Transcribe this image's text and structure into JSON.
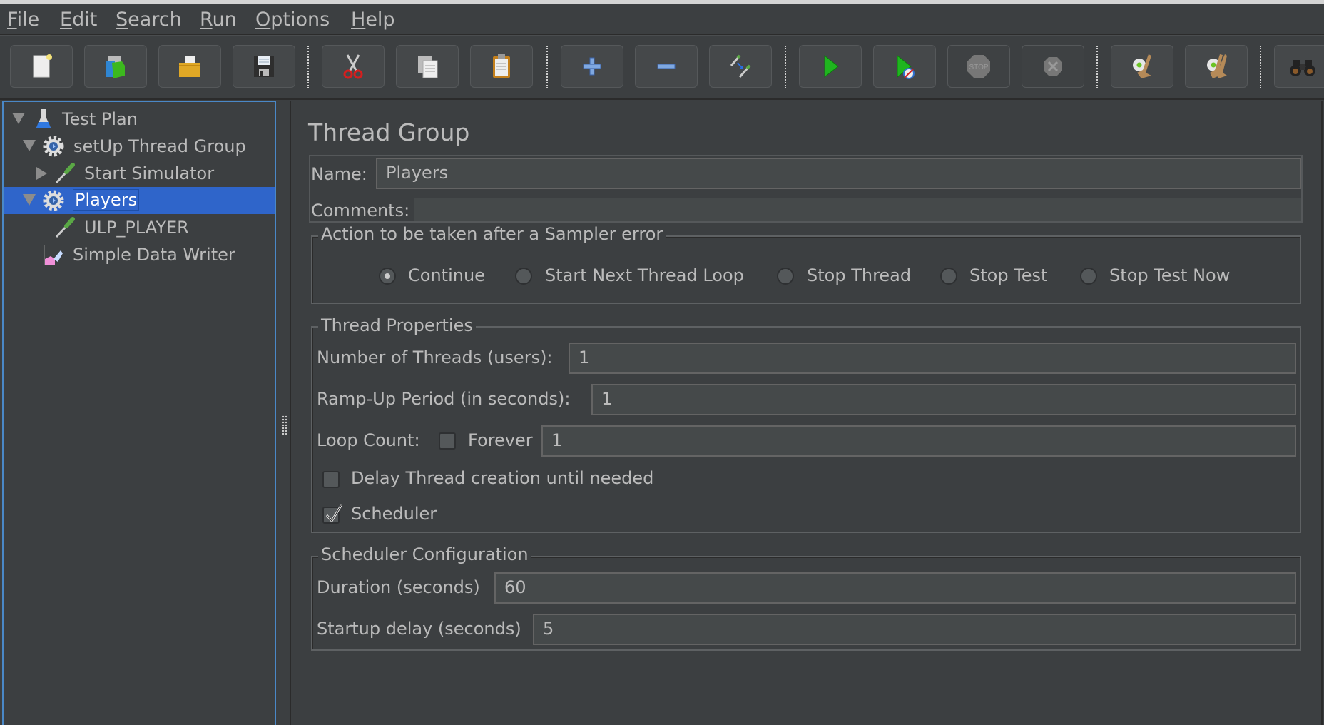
{
  "menu": [
    "File",
    "Edit",
    "Search",
    "Run",
    "Options",
    "Help"
  ],
  "menu_mnemonics": [
    "F",
    "E",
    "S",
    "R",
    "O",
    "H"
  ],
  "toolbar": {
    "buttons": [
      {
        "name": "new",
        "icon": "new-document-icon",
        "enabled": true
      },
      {
        "name": "templates",
        "icon": "templates-icon",
        "enabled": true
      },
      {
        "name": "open",
        "icon": "open-folder-icon",
        "enabled": true
      },
      {
        "name": "save",
        "icon": "save-floppy-icon",
        "enabled": true
      },
      {
        "name": "cut",
        "icon": "scissors-icon",
        "enabled": true
      },
      {
        "name": "copy",
        "icon": "copy-icon",
        "enabled": true
      },
      {
        "name": "paste",
        "icon": "paste-clipboard-icon",
        "enabled": true
      },
      {
        "name": "expand-all",
        "icon": "plus-icon",
        "enabled": true
      },
      {
        "name": "collapse-all",
        "icon": "minus-icon",
        "enabled": true
      },
      {
        "name": "toggle",
        "icon": "toggle-pipette-icon",
        "enabled": true
      },
      {
        "name": "start",
        "icon": "play-icon",
        "enabled": true
      },
      {
        "name": "start-no-pauses",
        "icon": "play-no-timers-icon",
        "enabled": true
      },
      {
        "name": "stop",
        "icon": "stop-sign-icon",
        "enabled": false
      },
      {
        "name": "shutdown",
        "icon": "shutdown-x-icon",
        "enabled": false
      },
      {
        "name": "clear",
        "icon": "clear-broom-icon",
        "enabled": true
      },
      {
        "name": "clear-all",
        "icon": "clear-all-broom-icon",
        "enabled": true
      },
      {
        "name": "search",
        "icon": "binoculars-icon",
        "enabled": true
      }
    ]
  },
  "tree": {
    "items": [
      {
        "label": "Test Plan",
        "icon": "test-plan-flask-icon",
        "expanded": true,
        "level": 0,
        "selected": false
      },
      {
        "label": "setUp Thread Group",
        "icon": "thread-group-gear-icon",
        "expanded": true,
        "level": 1,
        "selected": false
      },
      {
        "label": "Start Simulator",
        "icon": "sampler-pipette-icon",
        "expanded": false,
        "level": 2,
        "selected": false
      },
      {
        "label": "Players",
        "icon": "thread-group-gear-icon",
        "expanded": true,
        "level": 1,
        "selected": true
      },
      {
        "label": "ULP_PLAYER",
        "icon": "sampler-pipette-icon",
        "expanded": null,
        "level": 2,
        "selected": false
      },
      {
        "label": "Simple Data Writer",
        "icon": "listener-chart-icon",
        "expanded": null,
        "level": 1,
        "selected": false
      }
    ]
  },
  "panel": {
    "title": "Thread Group",
    "name_label": "Name:",
    "name_value": "Players",
    "comments_label": "Comments:",
    "comments_value": "",
    "sampler_error": {
      "legend": "Action to be taken after a Sampler error",
      "options": [
        "Continue",
        "Start Next Thread Loop",
        "Stop Thread",
        "Stop Test",
        "Stop Test Now"
      ],
      "selected": "Continue"
    },
    "thread_properties": {
      "legend": "Thread Properties",
      "num_threads_label": "Number of Threads (users):",
      "num_threads_value": "1",
      "rampup_label": "Ramp-Up Period (in seconds):",
      "rampup_value": "1",
      "loop_label": "Loop Count:",
      "forever_label": "Forever",
      "forever_checked": false,
      "loop_value": "1",
      "delay_label": "Delay Thread creation until needed",
      "delay_checked": false,
      "scheduler_label": "Scheduler",
      "scheduler_checked": true
    },
    "scheduler_config": {
      "legend": "Scheduler Configuration",
      "duration_label": "Duration (seconds)",
      "duration_value": "60",
      "startup_label": "Startup delay (seconds)",
      "startup_value": "5"
    }
  }
}
